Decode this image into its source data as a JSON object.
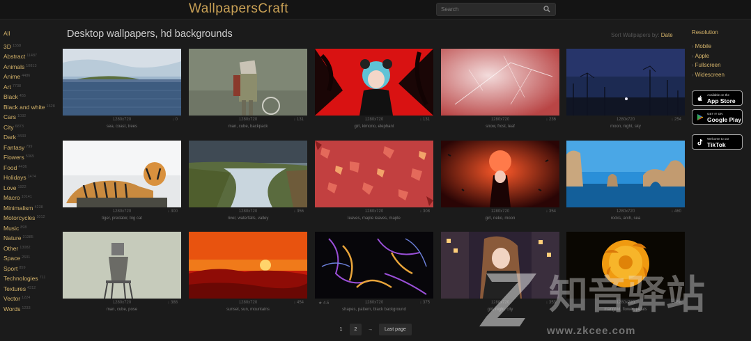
{
  "header": {
    "logo": "WallpapersCraft",
    "search_placeholder": "Search"
  },
  "sidebar": [
    {
      "label": "All",
      "count": ""
    },
    {
      "label": "3D",
      "count": "1558"
    },
    {
      "label": "Abstract",
      "count": "11487"
    },
    {
      "label": "Animals",
      "count": "10813"
    },
    {
      "label": "Anime",
      "count": "4486"
    },
    {
      "label": "Art",
      "count": "7738"
    },
    {
      "label": "Black",
      "count": "455"
    },
    {
      "label": "Black and white",
      "count": "1628"
    },
    {
      "label": "Cars",
      "count": "1032"
    },
    {
      "label": "City",
      "count": "6873"
    },
    {
      "label": "Dark",
      "count": "3433"
    },
    {
      "label": "Fantasy",
      "count": "799"
    },
    {
      "label": "Flowers",
      "count": "5365"
    },
    {
      "label": "Food",
      "count": "4436"
    },
    {
      "label": "Holidays",
      "count": "1474"
    },
    {
      "label": "Love",
      "count": "1922"
    },
    {
      "label": "Macro",
      "count": "10141"
    },
    {
      "label": "Minimalism",
      "count": "4238"
    },
    {
      "label": "Motorcycles",
      "count": "1012"
    },
    {
      "label": "Music",
      "count": "898"
    },
    {
      "label": "Nature",
      "count": "31385"
    },
    {
      "label": "Other",
      "count": "13082"
    },
    {
      "label": "Space",
      "count": "2601"
    },
    {
      "label": "Sport",
      "count": "859"
    },
    {
      "label": "Technologies",
      "count": "711"
    },
    {
      "label": "Textures",
      "count": "4312"
    },
    {
      "label": "Vector",
      "count": "1224"
    },
    {
      "label": "Words",
      "count": "1233"
    }
  ],
  "main": {
    "title": "Desktop wallpapers, hd backgrounds",
    "sort_label": "Sort Wallpapers by:",
    "sort_value": "Date"
  },
  "cards": [
    {
      "res": "1280x720",
      "dl": "↓ 0",
      "tags": "sea, coast, trees",
      "scene": "sea"
    },
    {
      "res": "1280x720",
      "dl": "↓ 131",
      "tags": "man, cube, backpack",
      "scene": "cube"
    },
    {
      "res": "1280x720",
      "dl": "↓ 131",
      "tags": "girl, kimono, elephant",
      "scene": "animegirl"
    },
    {
      "res": "1280x720",
      "dl": "↓ 236",
      "tags": "snow, frost, leaf",
      "scene": "frost"
    },
    {
      "res": "1280x720",
      "dl": "↓ 254",
      "tags": "moon, night, sky",
      "scene": "night"
    },
    {
      "res": "1280x720",
      "dl": "↓ 300",
      "tags": "tiger, predator, big cat",
      "scene": "tiger"
    },
    {
      "res": "1280x720",
      "dl": "↓ 356",
      "tags": "river, waterfalls, valley",
      "scene": "river"
    },
    {
      "res": "1280x720",
      "dl": "↓ 308",
      "tags": "leaves, maple leaves, maple",
      "scene": "leaves"
    },
    {
      "res": "1280x720",
      "dl": "↓ 354",
      "tags": "girl, neko, moon",
      "scene": "redmoon"
    },
    {
      "res": "1280x720",
      "dl": "↓ 460",
      "tags": "rocks, arch, sea",
      "scene": "rocks"
    },
    {
      "res": "1280x720",
      "dl": "↓ 388",
      "tags": "man, cube, pose",
      "scene": "cubeman"
    },
    {
      "res": "1280x720",
      "dl": "↓ 454",
      "tags": "sunset, sun, mountains",
      "scene": "sunset"
    },
    {
      "res": "1280x720",
      "dl": "↓ 375",
      "ltag": "★ 4.5",
      "tags": "shapes, pattern, black background",
      "scene": "fractal"
    },
    {
      "res": "1280x720",
      "dl": "↓ 353",
      "tags": "girl, night, city",
      "scene": "citygirl"
    },
    {
      "res": "1280x720",
      "dl": "↓ 458",
      "tags": "marigold, flower, petals",
      "scene": "marigold"
    }
  ],
  "rightbar": {
    "title": "Resolution",
    "items": [
      "Mobile",
      "Apple",
      "Fullscreen",
      "Widescreen"
    ],
    "stores": [
      {
        "small": "Available on the",
        "big": "App Store",
        "icon": "apple-icon"
      },
      {
        "small": "GET IT ON",
        "big": "Google Play",
        "icon": "google-play-icon"
      },
      {
        "small": "Welcome to our",
        "big": "TikTok",
        "icon": "tiktok-icon"
      }
    ]
  },
  "pager": {
    "p1": "1",
    "p2": "2",
    "next": "→",
    "last": "Last page"
  },
  "watermark": {
    "text": "知音驿站",
    "url": "www.zkcee.com"
  },
  "colors": {
    "accent": "#d4b36a",
    "bg": "#1b1b1b",
    "logo": "#c8a055"
  }
}
